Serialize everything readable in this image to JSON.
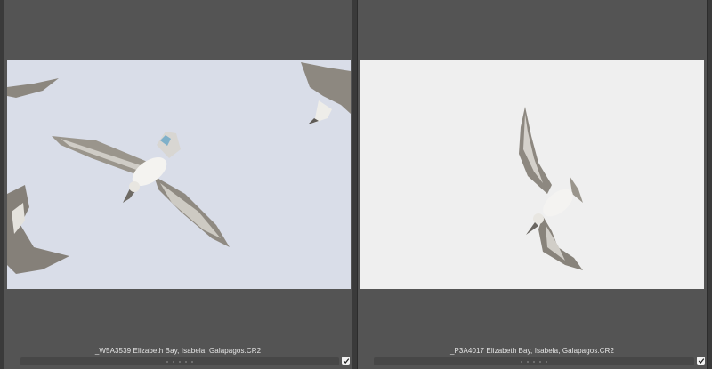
{
  "grid": {
    "items": [
      {
        "filename": "_W5A3539 Elizabeth Bay, Isabela, Galapagos.CR2",
        "selected": true
      },
      {
        "filename": "_P3A4017 Elizabeth Bay, Isabela, Galapagos.CR2",
        "selected": true
      }
    ]
  },
  "colors": {
    "cell_background": "#545454",
    "window_background": "#3a3a3a",
    "sky_left": "#d9dde8",
    "sky_right": "#efefef"
  },
  "icons": {
    "select": "checkbox-checked-icon"
  }
}
